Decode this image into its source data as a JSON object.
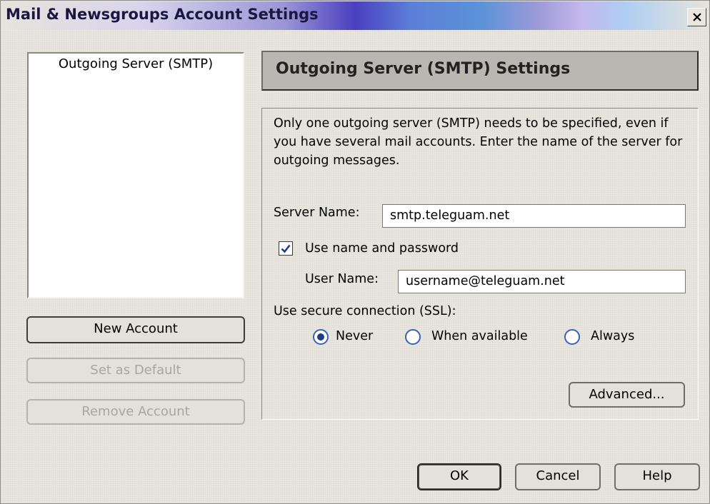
{
  "window": {
    "title": "Mail & Newsgroups Account Settings",
    "close_glyph": "✕"
  },
  "sidebar": {
    "accounts": [
      "Outgoing Server (SMTP)"
    ],
    "new_account": "New Account",
    "set_default": "Set as Default",
    "remove_account": "Remove Account"
  },
  "panel": {
    "title": "Outgoing Server (SMTP) Settings",
    "description": "Only one outgoing server (SMTP) needs to be specified, even if you have several mail accounts. Enter the name of the server for outgoing messages.",
    "server_name_label": "Server Name:",
    "server_name_value": "smtp.teleguam.net",
    "use_password_label": "Use name and password",
    "use_password_checked": true,
    "user_name_label": "User Name:",
    "user_name_value": "username@teleguam.net",
    "ssl_label": "Use secure connection (SSL):",
    "ssl_options": [
      "Never",
      "When available",
      "Always"
    ],
    "ssl_selected": "Never",
    "advanced": "Advanced..."
  },
  "footer": {
    "ok": "OK",
    "cancel": "Cancel",
    "help": "Help"
  }
}
